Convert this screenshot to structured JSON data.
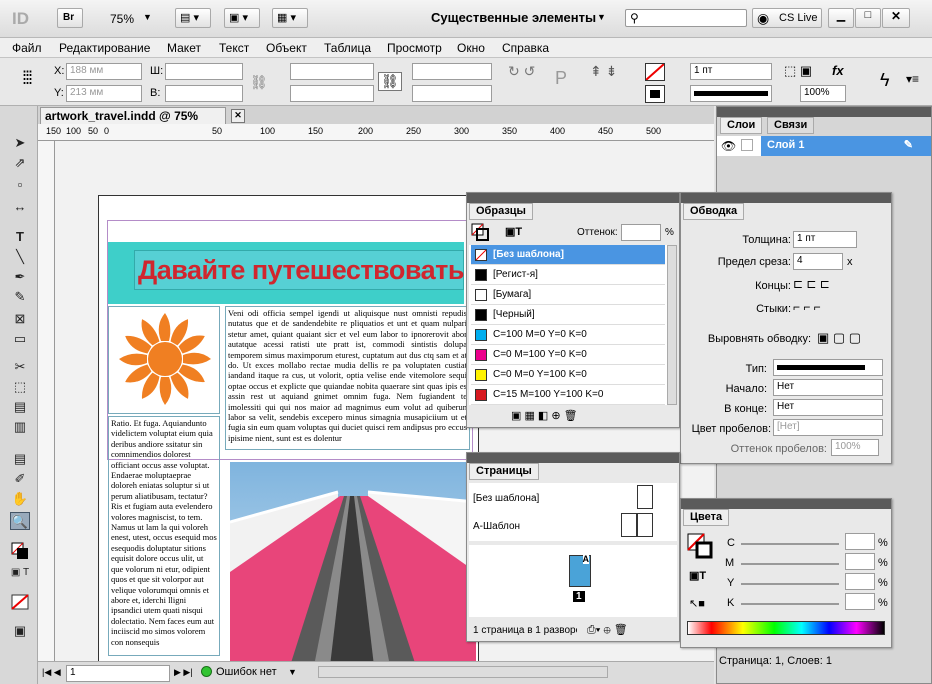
{
  "app": {
    "logo": "ID",
    "bridge_label": "Br",
    "zoom": "75%",
    "workspace": "Существенные элементы",
    "search_placeholder": "",
    "cslive": "CS Live"
  },
  "menu": [
    "Файл",
    "Редактирование",
    "Макет",
    "Текст",
    "Объект",
    "Таблица",
    "Просмотр",
    "Окно",
    "Справка"
  ],
  "control": {
    "x_label": "X:",
    "x_value": "188 мм",
    "y_label": "Y:",
    "y_value": "213 мм",
    "w_label": "Ш:",
    "h_label": "В:",
    "stroke_weight": "1 пт",
    "zoom_pct": "100%"
  },
  "document": {
    "tab": "artwork_travel.indd @ 75%",
    "ruler_labels": [
      "150",
      "100",
      "50",
      "0",
      "50",
      "100",
      "150",
      "200",
      "250",
      "300",
      "350",
      "400",
      "450",
      "500"
    ]
  },
  "page": {
    "headline": "Давайте путешествовать!",
    "col_right": "Veni odi officia sempel igendi ut aliquisque nust omnisti repudis nutatus que et de sandendebite re pliquatios et unt et quam nulpari stetur amet, quiant quaiant sicr et vel eum labor to ipnorerovit abor autatque acessi ratisti ute pratt ist, commodi sintistis dolupa temporem simus maximporum eturest, cuptatum aut dus ctq sam et at do. Ut exces mollabo rectae mudia dellis re pa voluptaten custiat iandand itaque ra cus, ut volorit, optia velise ende vitemolore sequi optae occus et explicte que quiandae nobita quaerare sint quas ipis es assin rest ut aquiand gnimet omnim fuga. Nem fugiandent te imolessiti qui qui nos maior ad magnimus eum volut ad quiberun labor sa velit, sendebis excepero minus simagnia musapiciium ut et fugia sin eum quam voluptas qui duciet quisci rem andipsus pro eccus ipisime nient, sunt est es dolentur",
    "col_left": "Ratio. Et fuga. Aquiandunto videlictem voluptat eium quia deribus andiore ssitatur sin comnimendios dolorest officiant occus asse voluptat. Endaerae moluptaeprae doloreh eniatas soluptur si ut perum aliatibusam, tectatur? Ris et fugiam auta evelendero volores magniscist, to tem. Namus ut lam la qui voloreh enest, utest, occus esequid mos esequodis doluptatur sitions equisit dolore occus ulit, ut que volorum ni etur, odipient quos et que sit volorpor aut velique volorumqui omnis et abore et, iderchi lligni ipsandici utem quati nisqui dolectatio. Nem faces eum aut inciiscid mo simos volorem con nonsequis"
  },
  "status": {
    "page": "1",
    "errors": "Ошибок нет"
  },
  "layers": {
    "tab1": "Слои",
    "tab2": "Связи",
    "layer": "Слой 1",
    "footer": "Страница: 1, Слоев: 1"
  },
  "swatches": {
    "title": "Образцы",
    "tint_label": "Оттенок:",
    "tint_unit": "%",
    "items": [
      {
        "name": "[Без шаблона]",
        "color": "none"
      },
      {
        "name": "[Регист-я]",
        "color": "#000000"
      },
      {
        "name": "[Бумага]",
        "color": "#ffffff"
      },
      {
        "name": "[Черный]",
        "color": "#000000"
      },
      {
        "name": "C=100 M=0 Y=0 K=0",
        "color": "#00aeef"
      },
      {
        "name": "C=0 M=100 Y=0 K=0",
        "color": "#ec008c"
      },
      {
        "name": "C=0 M=0 Y=100 K=0",
        "color": "#fff200"
      },
      {
        "name": "C=15 M=100 Y=100 K=0",
        "color": "#d71920"
      }
    ]
  },
  "stroke": {
    "title": "Обводка",
    "weight_label": "Толщина:",
    "weight": "1 пт",
    "miter_label": "Предел среза:",
    "miter": "4",
    "miter_unit": "x",
    "cap_label": "Концы:",
    "join_label": "Стыки:",
    "align_label": "Выровнять обводку:",
    "type_label": "Тип:",
    "start_label": "Начало:",
    "start": "Нет",
    "end_label": "В конце:",
    "end": "Нет",
    "gap_label": "Цвет пробелов:",
    "gap": "[Нет]",
    "gaptint_label": "Оттенок пробелов:",
    "gaptint": "100%"
  },
  "pages": {
    "title": "Страницы",
    "none": "[Без шаблона]",
    "master": "A-Шаблон",
    "page_num": "1",
    "master_letter": "A",
    "footer": "1 страница в 1 разворо"
  },
  "colors": {
    "title": "Цвета",
    "channels": [
      "C",
      "M",
      "Y",
      "K"
    ],
    "unit": "%"
  }
}
